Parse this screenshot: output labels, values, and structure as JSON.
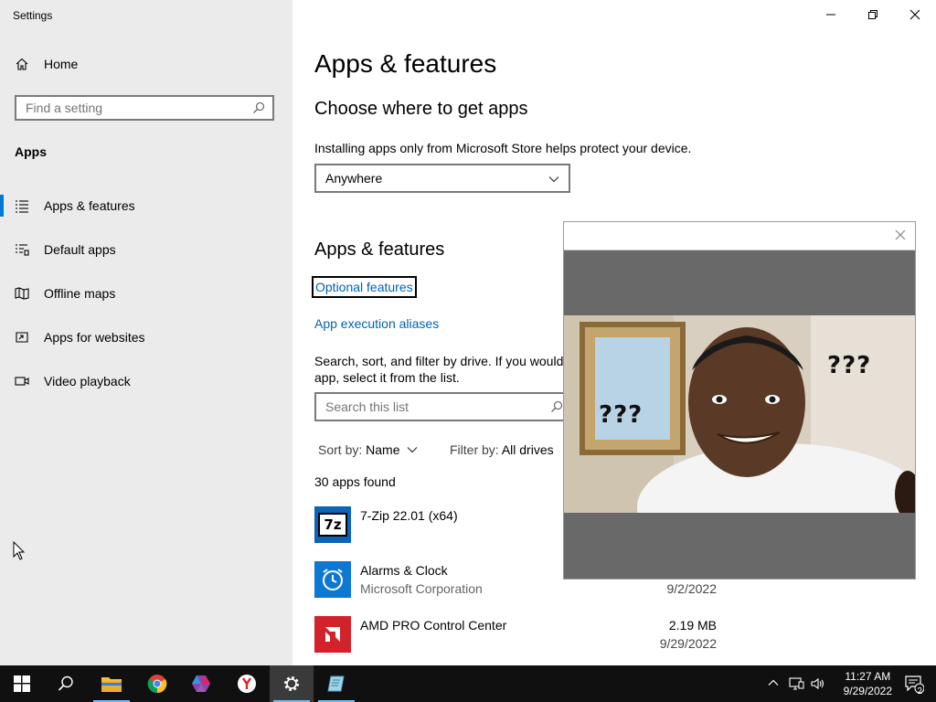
{
  "window": {
    "title": "Settings"
  },
  "sidebar": {
    "home_label": "Home",
    "search_placeholder": "Find a setting",
    "section_label": "Apps",
    "items": [
      {
        "label": "Apps & features",
        "icon": "list-icon",
        "active": true
      },
      {
        "label": "Default apps",
        "icon": "default-apps-icon"
      },
      {
        "label": "Offline maps",
        "icon": "map-icon"
      },
      {
        "label": "Apps for websites",
        "icon": "link-window-icon"
      },
      {
        "label": "Video playback",
        "icon": "video-icon"
      }
    ]
  },
  "main": {
    "title": "Apps & features",
    "choose_heading": "Choose where to get apps",
    "choose_desc": "Installing apps only from Microsoft Store helps protect your device.",
    "source_selected": "Anywhere",
    "section_heading": "Apps & features",
    "optional_features_link": "Optional features",
    "execution_aliases_link": "App execution aliases",
    "search_desc": "Search, sort, and filter by drive. If you would like to uninstall or move an app, select it from the list.",
    "search_desc_visible": "Search, sort, and filter by drive. If you would",
    "search_desc_line2": "app, select it from the list.",
    "list_search_placeholder": "Search this list",
    "sort_prefix": "Sort by:",
    "sort_value": "Name",
    "filter_prefix": "Filter by:",
    "filter_value": "All drives",
    "apps_found": "30 apps found",
    "apps": [
      {
        "name": "7-Zip 22.01 (x64)",
        "publisher": "",
        "size": "",
        "date": ""
      },
      {
        "name": "Alarms & Clock",
        "publisher": "Microsoft Corporation",
        "size": "",
        "date": "9/2/2022"
      },
      {
        "name": "AMD PRO Control Center",
        "publisher": "",
        "size": "2.19 MB",
        "date": "9/29/2022"
      }
    ]
  },
  "popup": {
    "meme_text_left": "???",
    "meme_text_right": "???"
  },
  "taskbar": {
    "time": "11:27 AM",
    "date": "9/29/2022",
    "notification_count": "2"
  },
  "colors": {
    "accent": "#0078d7",
    "link": "#0063b1",
    "sidebar_bg": "#ebebeb",
    "taskbar_bg": "#101010"
  }
}
